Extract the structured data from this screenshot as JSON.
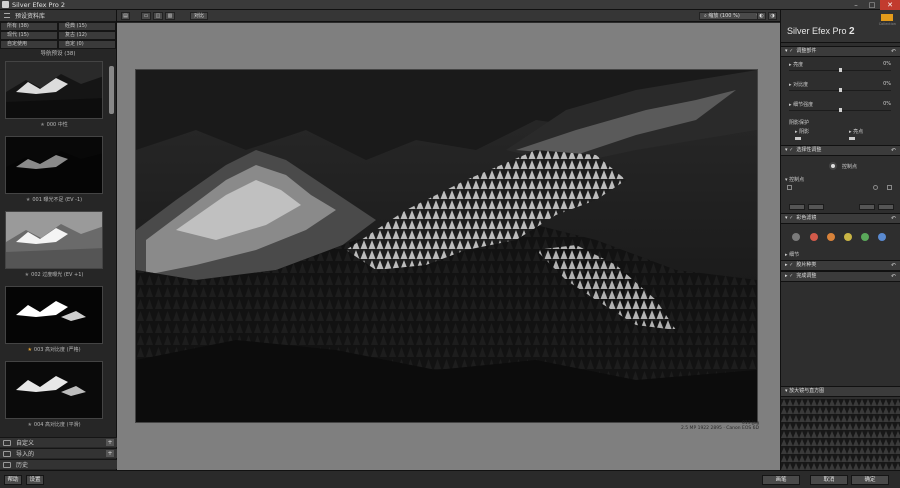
{
  "window": {
    "title": "Silver Efex Pro 2"
  },
  "left_panel": {
    "header": "预设资料库",
    "categories": [
      {
        "label": "所有 (38)"
      },
      {
        "label": "经典 (15)"
      },
      {
        "label": "现代 (15)"
      },
      {
        "label": "复古 (12)"
      },
      {
        "label": "自定使用"
      },
      {
        "label": "自定 (0)"
      }
    ],
    "preset_list_title": "导航预设 (38)",
    "presets": [
      {
        "label": "000 中性",
        "star": false
      },
      {
        "label": "001 曝光不足 (EV -1)",
        "star": false
      },
      {
        "label": "002 过度曝光 (EV +1)",
        "star": false
      },
      {
        "label": "003 高对比度 (严格)",
        "star": true
      },
      {
        "label": "004 高对比度 (平滑)",
        "star": false
      }
    ],
    "bottom_sections": [
      {
        "label": "自定义"
      },
      {
        "label": "导入的"
      },
      {
        "label": "历史"
      }
    ]
  },
  "toolbar": {
    "compare_label": "对比",
    "zoom_label": "缩放 (100 %)"
  },
  "image": {
    "filename": "013.jpg",
    "info": "2.5 MP 1922 2895 · Canon EOS 6D"
  },
  "right_panel": {
    "brand_name": "Silver Efex Pro",
    "brand_version": "2",
    "logo_text": "Collection",
    "global_adjustments": {
      "title": "调整部件",
      "sliders": [
        {
          "label": "亮度",
          "value": "0%"
        },
        {
          "label": "对比度",
          "value": "0%"
        },
        {
          "label": "细节强度",
          "value": "0%"
        }
      ],
      "tone_protection_label": "阴影保护",
      "shadows_label": "阴影",
      "highlights_label": "亮点"
    },
    "selective": {
      "title": "选择性调整",
      "control_point_label": "控制点",
      "list_label": "控制点"
    },
    "color_filter": {
      "title": "彩色滤镜",
      "colors": [
        "#7a7a7a",
        "#d25a4a",
        "#d8823a",
        "#c9b545",
        "#5aa85a",
        "#5a8ad0"
      ],
      "details_label": "细节"
    },
    "film_types": {
      "title": "胶片种类"
    },
    "finishing": {
      "title": "完成调整"
    },
    "loupe": {
      "title": "放大镜与直方图"
    }
  },
  "bottom_bar": {
    "help_label": "帮助",
    "settings_label": "设置",
    "brush_label": "画笔",
    "cancel_label": "取消",
    "ok_label": "确定"
  }
}
